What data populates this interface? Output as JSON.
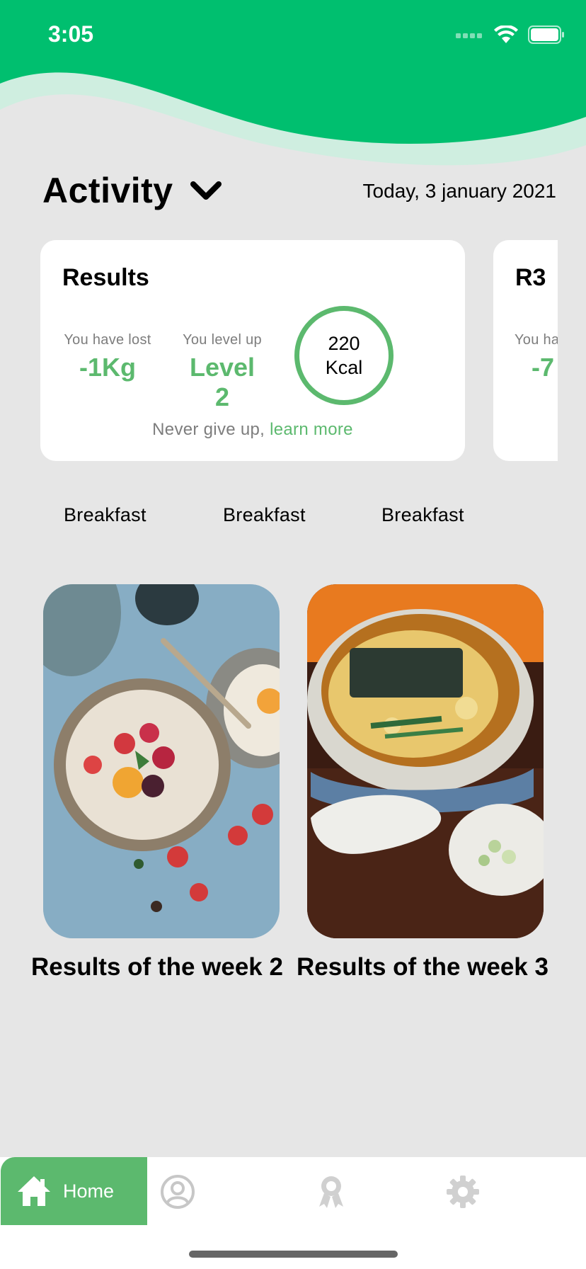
{
  "status_bar": {
    "time": "3:05"
  },
  "header": {
    "title": "Activity",
    "date": "Today, 3 january 2021"
  },
  "cards": [
    {
      "title": "Results",
      "lost_label": "You have lost",
      "lost_value": "-1Kg",
      "level_label": "You level up",
      "level_value": "Level 2",
      "kcal_value": "220",
      "kcal_unit": "Kcal",
      "motto": "Never give up,",
      "learn_more": "learn more"
    },
    {
      "title": "R3",
      "lost_label": "You ha",
      "lost_value": "-7"
    }
  ],
  "meal_tabs": [
    "Breakfast",
    "Breakfast",
    "Breakfast"
  ],
  "photos": [
    {
      "caption": "Results of the week 2",
      "icon": "food-photo-oatmeal-bowl"
    },
    {
      "caption": "Results of the week 3",
      "icon": "food-photo-ramen-bowl"
    }
  ],
  "bottom_nav": {
    "home_label": "Home",
    "items": [
      "home-icon",
      "profile-icon",
      "award-icon",
      "settings-icon"
    ]
  },
  "colors": {
    "brand_green": "#00bf6f",
    "accent_green": "#5cb96e",
    "wave_light": "#cfeee0",
    "background": "#e6e6e6"
  }
}
